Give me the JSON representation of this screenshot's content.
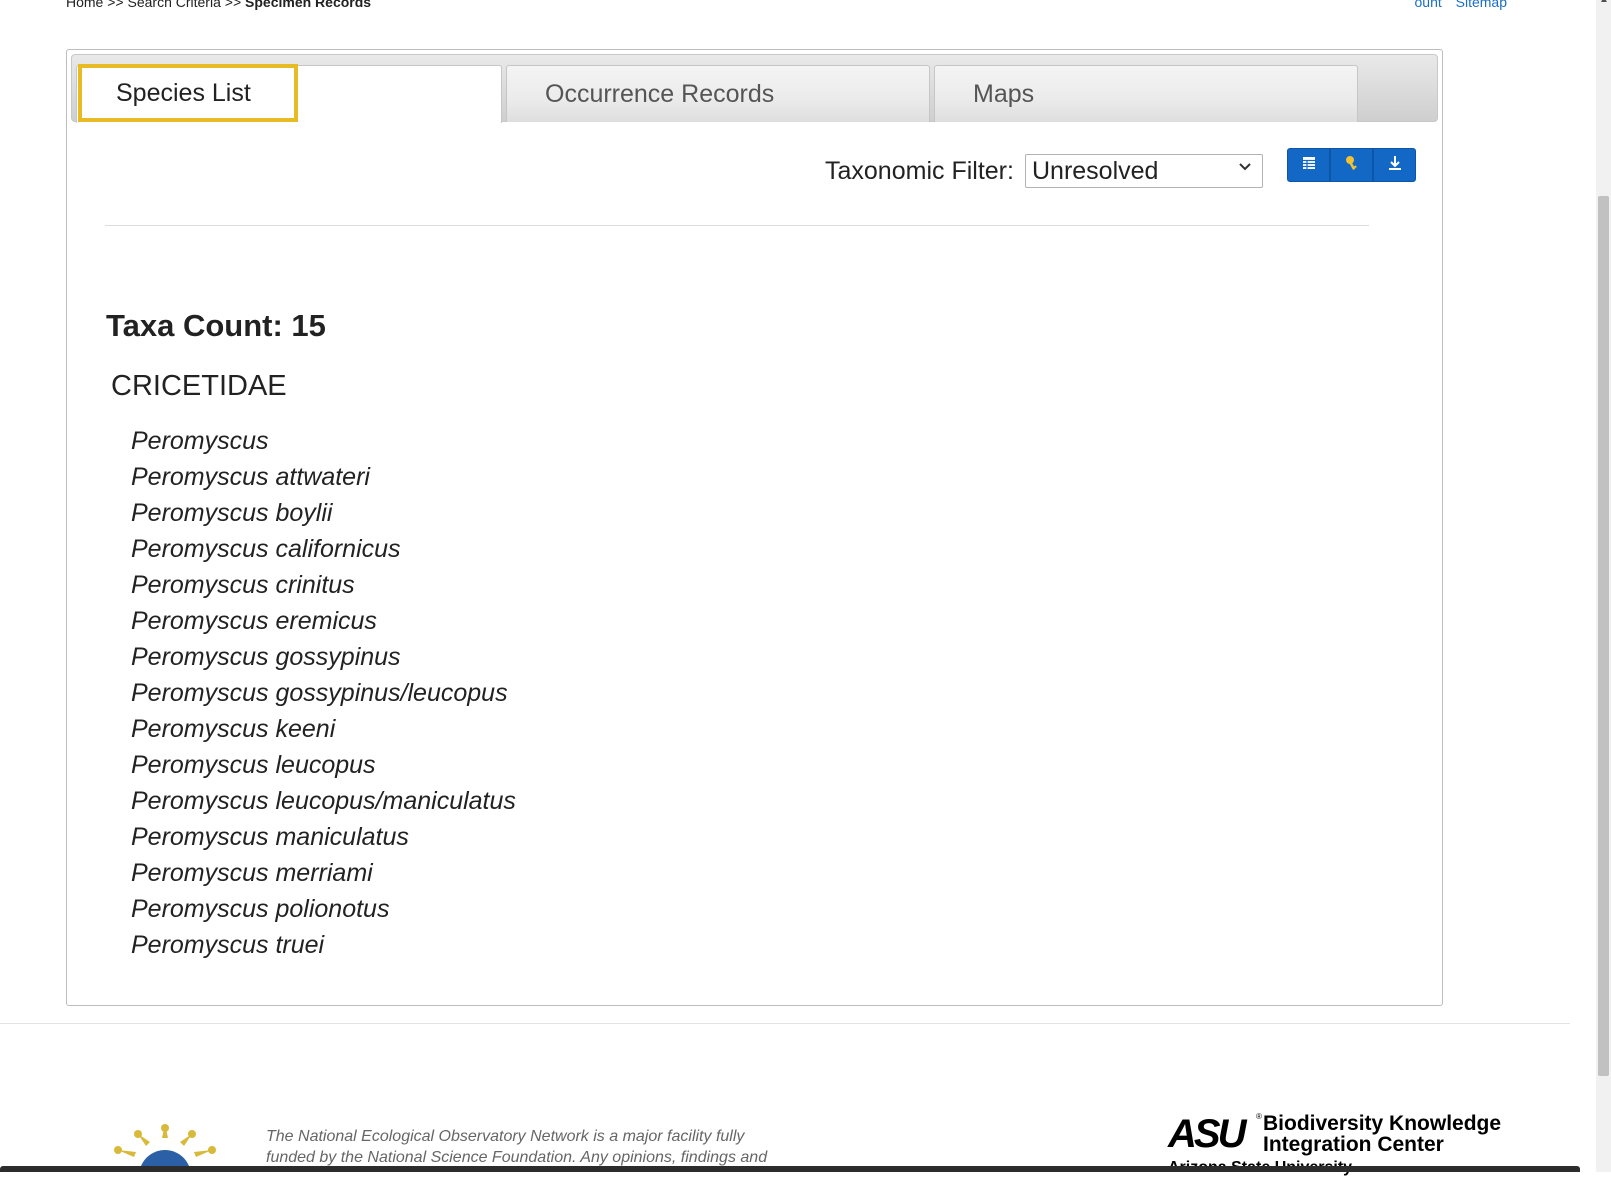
{
  "breadcrumb": {
    "home": "Home",
    "sep": ">>",
    "search": "Search Criteria",
    "current": "Specimen Records"
  },
  "toplinks": {
    "account_partial": "ount",
    "sitemap": "Sitemap"
  },
  "tabs": [
    {
      "label": "Species List",
      "active": true
    },
    {
      "label": "Occurrence Records",
      "active": false
    },
    {
      "label": "Maps",
      "active": false
    }
  ],
  "filter": {
    "label": "Taxonomic Filter:",
    "selected": "Unresolved"
  },
  "toolbar": {
    "icons": [
      "table-icon",
      "key-icon",
      "download-icon"
    ],
    "color": "#1468c5"
  },
  "taxa_count": "Taxa Count: 15",
  "family": "CRICETIDAE",
  "species": [
    "Peromyscus",
    "Peromyscus attwateri",
    "Peromyscus boylii",
    "Peromyscus californicus",
    "Peromyscus crinitus",
    "Peromyscus eremicus",
    "Peromyscus gossypinus",
    "Peromyscus gossypinus/leucopus",
    "Peromyscus keeni",
    "Peromyscus leucopus",
    "Peromyscus leucopus/maniculatus",
    "Peromyscus maniculatus",
    "Peromyscus merriami",
    "Peromyscus polionotus",
    "Peromyscus truei"
  ],
  "footer": {
    "text": "The National Ecological Observatory Network is a major facility fully funded by the National Science Foundation. Any opinions, findings and",
    "asu_mark": "ASU",
    "asu_name": "Biodiversity Knowledge Integration Center",
    "asu_sub": "Arizona State University"
  }
}
